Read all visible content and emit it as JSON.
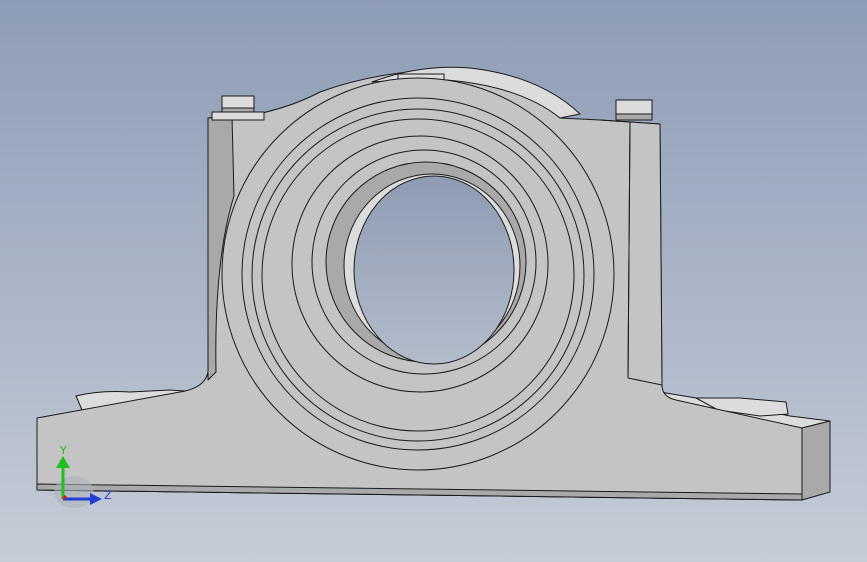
{
  "viewport": {
    "background_top": "#8d9cb6",
    "background_bottom": "#c6ccd7"
  },
  "model": {
    "body_color": "#c4c4c4",
    "shadow_color": "#a9a9a9",
    "highlight_color": "#dcdcdc",
    "edge_color": "#1a1a1a"
  },
  "triad": {
    "y_label": "Y",
    "z_label": "Z",
    "y_color": "#1fbf1f",
    "z_color": "#1f3fd6",
    "x_color": "#d41f1f"
  }
}
